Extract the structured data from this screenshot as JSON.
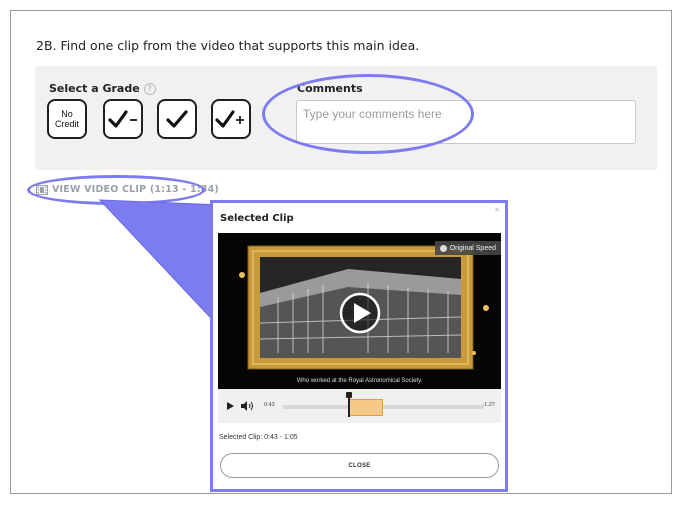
{
  "question": {
    "text": "2B. Find one clip from the video that supports this main idea."
  },
  "grade": {
    "label": "Select a Grade",
    "help_icon": "question-circle-icon",
    "options": [
      {
        "name": "no-credit",
        "label": "No\nCredit"
      },
      {
        "name": "check-minus",
        "icon": "check-minus-icon"
      },
      {
        "name": "check",
        "icon": "check-icon"
      },
      {
        "name": "check-plus",
        "icon": "check-plus-icon"
      }
    ]
  },
  "comments": {
    "label": "Comments",
    "placeholder": "Type your comments here"
  },
  "clip_link": {
    "icon": "film-icon",
    "text": "VIEW VIDEO CLIP (1:13 - 1:34)"
  },
  "popup": {
    "title": "Selected Clip",
    "close_icon": "close-icon",
    "video": {
      "speed_label": "Original Speed",
      "caption": "Who worked at the Royal Astronomical Society."
    },
    "controls": {
      "elapsed": "0:43",
      "remaining": "-1:27",
      "progress": 0.33,
      "selection_start": 0.33,
      "selection_end": 0.5
    },
    "selected_info": "Selected Clip: 0:43 - 1:05",
    "close_label": "CLOSE"
  },
  "colors": {
    "highlight": "#7c7cf0",
    "selection": "#f5c98a",
    "frame_gold": "#c99a3a"
  }
}
